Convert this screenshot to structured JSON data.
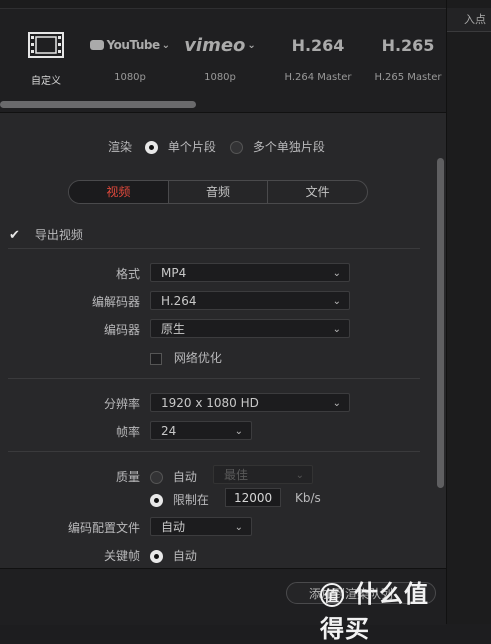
{
  "presets": [
    {
      "logo": "▭",
      "label": "自定义",
      "selected": true
    },
    {
      "logo": "▶YouTube⌄",
      "label": "1080p"
    },
    {
      "logo": "vimeo⌄",
      "label": "1080p"
    },
    {
      "logo": "H.264",
      "label": "H.264 Master"
    },
    {
      "logo": "H.265",
      "label": "H.265 Master"
    }
  ],
  "right_panel": {
    "header": "入点"
  },
  "render": {
    "label": "渲染",
    "opt_single": "单个片段",
    "opt_multi": "多个单独片段",
    "selected": "single"
  },
  "tabs": [
    {
      "label": "视频",
      "active": true
    },
    {
      "label": "音频"
    },
    {
      "label": "文件"
    }
  ],
  "export_video": {
    "label": "导出视频",
    "checked": true
  },
  "format": {
    "label": "格式",
    "value": "MP4"
  },
  "codec": {
    "label": "编解码器",
    "value": "H.264"
  },
  "encoder": {
    "label": "编码器",
    "value": "原生"
  },
  "network_opt": {
    "label": "网络优化",
    "checked": false
  },
  "resolution": {
    "label": "分辨率",
    "value": "1920 x 1080 HD"
  },
  "framerate": {
    "label": "帧率",
    "value": "24"
  },
  "quality": {
    "label": "质量",
    "auto_label": "自动",
    "auto_value": "最佳",
    "limit_label": "限制在",
    "limit_value": "12000",
    "unit": "Kb/s",
    "selected": "limit"
  },
  "encode_profile": {
    "label": "编码配置文件",
    "value": "自动"
  },
  "keyframe": {
    "label": "关键帧",
    "auto_label": "自动"
  },
  "bottom": {
    "add_button": "添加到渲染队列"
  },
  "watermark": {
    "text": "值",
    "text2": "什么值得买"
  }
}
